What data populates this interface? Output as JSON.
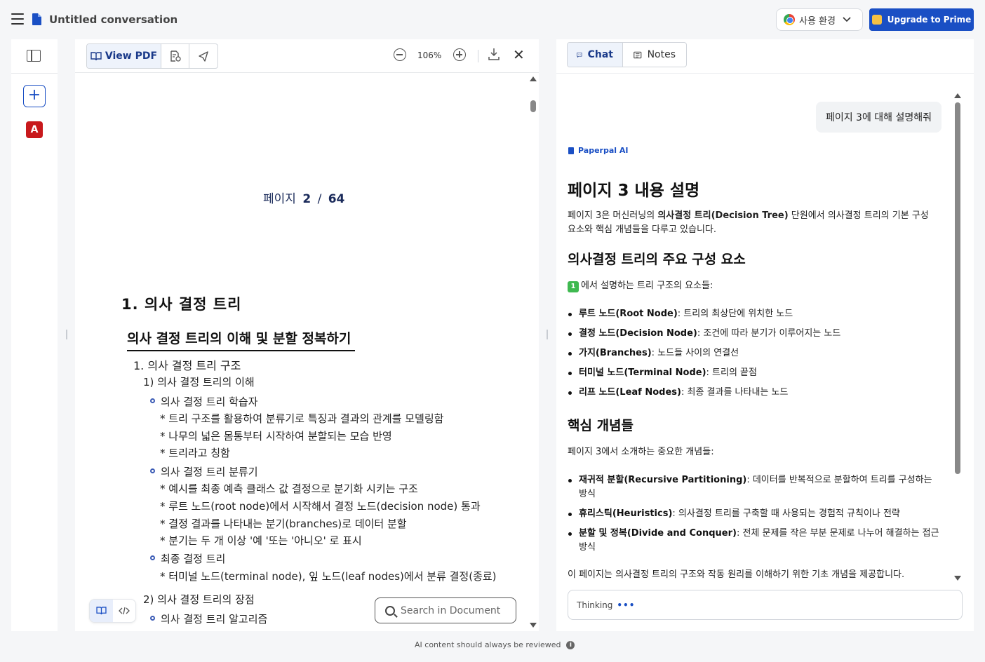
{
  "topbar": {
    "title": "Untitled conversation",
    "env_select_label": "사용 환경",
    "upgrade_label": "Upgrade to Prime"
  },
  "rail": {
    "new_label": "+",
    "pdf_label": "A"
  },
  "pdf": {
    "toolbar": {
      "view_pdf_label": "View PDF",
      "zoom_level": "106%"
    },
    "page_indicator": {
      "label": "페이지",
      "current": "2",
      "separator": "/",
      "total": "64"
    },
    "heading1": "1.  의사  결정  트리",
    "heading2": "의사 결정 트리의 이해 및 분할 정복하기",
    "lines": [
      "1. 의사 결정 트리 구조",
      "1) 의사 결정 트리의 이해",
      "의사 결정 트리 학습자",
      "* 트리 구조를 활용하여 분류기로 특징과 결과의 관계를 모델링함",
      "* 나무의 넓은 몸통부터 시작하여 분할되는 모습 반영",
      "* 트리라고 칭함",
      "의사 결정 트리 분류기",
      "* 예시를 최종 예측 클래스 값 결정으로 분기화 시키는 구조",
      "* 루트 노드(root node)에서 시작해서 결정 노드(decision node) 통과",
      "* 결정 결과를 나타내는 분기(branches)로 데이터 분할",
      "* 분기는 두 개 이상 '예 '또는 '아니오' 로 표시",
      "최종 결정 트리",
      "* 터미널 노드(terminal node), 잎 노드(leaf nodes)에서 분류 결정(종료)",
      "2) 의사 결정 트리의 장점",
      "의사 결정 트리 알고리즘"
    ],
    "search_placeholder": "Search in Document"
  },
  "chat": {
    "tabs": {
      "chat": "Chat",
      "notes": "Notes"
    },
    "user_message": "페이지 3에 대해 설명해줘",
    "ai_label": "Paperpal AI",
    "answer": {
      "title": "페이지 3 내용 설명",
      "intro_pre": "페이지 3은 머신러닝의 ",
      "intro_bold": "의사결정 트리",
      "intro_bold2": "(Decision Tree)",
      "intro_post": " 단원에서 의사결정 트리의 기본 구성 요소와 핵심 개념들을 다루고 있습니다.",
      "section1_title": "의사결정 트리의 주요 구성 요소",
      "ref_badge": "1",
      "section1_lead": "에서 설명하는 트리 구조의 요소들:",
      "components": [
        {
          "term": "루트 노드(Root Node)",
          "desc": ": 트리의 최상단에 위치한 노드"
        },
        {
          "term": "결정 노드(Decision Node)",
          "desc": ": 조건에 따라 분기가 이루어지는 노드"
        },
        {
          "term": "가지(Branches)",
          "desc": ": 노드들 사이의 연결선"
        },
        {
          "term": "터미널 노드(Terminal Node)",
          "desc": ": 트리의 끝점"
        },
        {
          "term": "리프 노드(Leaf Nodes)",
          "desc": ": 최종 결과를 나타내는 노드"
        }
      ],
      "section2_title": "핵심 개념들",
      "section2_lead": "페이지 3에서 소개하는 중요한 개념들:",
      "concepts": [
        {
          "term": "재귀적 분할(Recursive Partitioning)",
          "desc": ": 데이터를 반복적으로 분할하여 트리를 구성하는 방식"
        },
        {
          "term": "휴리스틱(Heuristics)",
          "desc": ": 의사결정 트리를 구축할 때 사용되는 경험적 규칙이나 전략"
        },
        {
          "term": "분할 및 정복(Divide and Conquer)",
          "desc": ": 전체 문제를 작은 부분 문제로 나누어 해결하는 접근 방식"
        }
      ],
      "conclusion": "이 페이지는 의사결정 트리의 구조와 작동 원리를 이해하기 위한 기초 개념을 제공합니다."
    },
    "input_status": "Thinking",
    "input_dots": "•••"
  },
  "footer": {
    "note": "AI content should always be reviewed",
    "info_glyph": "i"
  },
  "colors": {
    "accent": "#1a4fc4",
    "background": "#f5f6f8",
    "ref_badge": "#3fb950",
    "pdf_icon": "#c8191c"
  },
  "icons": [
    "hamburger-icon",
    "doc-icon",
    "chrome-icon",
    "chevron-down-icon",
    "crown-icon",
    "panel-toggle-icon",
    "plus-icon",
    "pdf-icon",
    "book-icon",
    "doc-info-icon",
    "share-icon",
    "zoom-out-icon",
    "zoom-in-icon",
    "download-icon",
    "close-icon",
    "code-icon",
    "search-icon",
    "chat-icon",
    "notes-icon",
    "info-icon"
  ]
}
